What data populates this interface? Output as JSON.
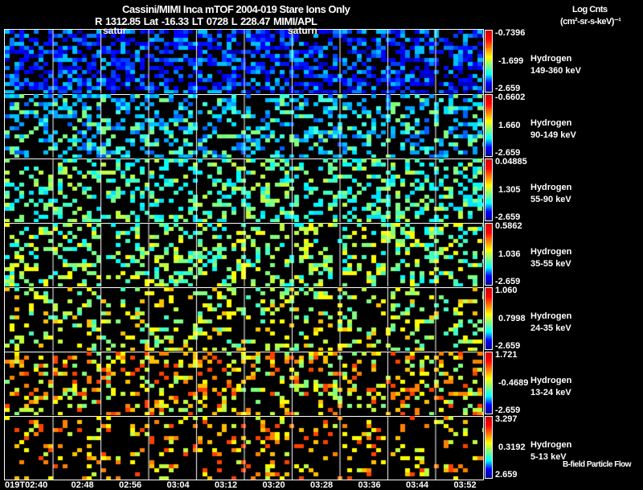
{
  "header": {
    "title": "Cassini/MIMI Inca mTOF  2004-019    Stare    Ions Only",
    "subtitle": "R         1312.85 Lat -16.33 LT 0728 L          228.47  MIMI/APL",
    "units_line1": "Log Cnts",
    "units_line2": "(cm²-sr-s-keV)⁻¹"
  },
  "overlay_labels": [
    "satur",
    "saturn"
  ],
  "chart_data": {
    "type": "heatmap",
    "title": "Cassini/MIMI Inca mTOF  2004-019    Stare    Ions Only",
    "colorbar_label": "Log Cnts (cm²-sr-s-keV)⁻¹",
    "x_tick_labels": [
      "019T02:40",
      "02:48",
      "02:56",
      "03:04",
      "03:12",
      "03:20",
      "03:28",
      "03:36",
      "03:44",
      "03:52"
    ],
    "rows": [
      {
        "species": "Hydrogen",
        "energy": "149-360 keV",
        "max": "-0.7396",
        "mid": "-1.699",
        "min": "-2.659",
        "dominant_color": "blue"
      },
      {
        "species": "Hydrogen",
        "energy": "90-149 keV",
        "max": "-0.6602",
        "mid": "1.660",
        "min": "-2.659",
        "dominant_color": "cyan"
      },
      {
        "species": "Hydrogen",
        "energy": "55-90 keV",
        "max": "0.04885",
        "mid": "1.305",
        "min": "-2.659",
        "dominant_color": "cyan-green"
      },
      {
        "species": "Hydrogen",
        "energy": "35-55 keV",
        "max": "0.5862",
        "mid": "1.036",
        "min": "-2.659",
        "dominant_color": "green"
      },
      {
        "species": "Hydrogen",
        "energy": "24-35 keV",
        "max": "1.060",
        "mid": "0.7998",
        "min": "-2.659",
        "dominant_color": "green-yellow"
      },
      {
        "species": "Hydrogen",
        "energy": "13-24 keV",
        "max": "1.721",
        "mid": "-0.4689",
        "min": "-2.659",
        "dominant_color": "yellow"
      },
      {
        "species": "Hydrogen",
        "energy": "5-13 keV",
        "max": "3.297",
        "mid": "0.3192",
        "min": "2.659",
        "dominant_color": "yellow-orange"
      }
    ]
  },
  "footer": {
    "legend_text": "B-field Particle Flow"
  }
}
